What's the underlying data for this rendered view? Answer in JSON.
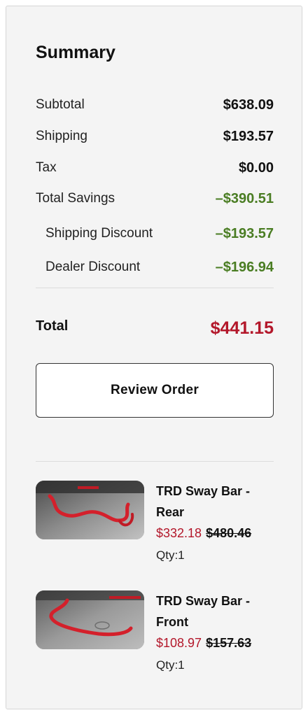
{
  "summary": {
    "title": "Summary",
    "rows": [
      {
        "label": "Subtotal",
        "value": "$638.09"
      },
      {
        "label": "Shipping",
        "value": "$193.57"
      },
      {
        "label": "Tax",
        "value": "$0.00"
      },
      {
        "label": "Total Savings",
        "value": "–$390.51"
      },
      {
        "label": "Shipping Discount",
        "value": "–$193.57"
      },
      {
        "label": "Dealer Discount",
        "value": "–$196.94"
      }
    ],
    "total_label": "Total",
    "total_value": "$441.15",
    "review_button": "Review Order"
  },
  "items": [
    {
      "name_line1": "TRD Sway Bar -",
      "name_line2": "Rear",
      "sale_price": "$332.18",
      "original_price": "$480.46",
      "qty": "Qty:1",
      "image": "red-sway-bar-rear-photo"
    },
    {
      "name_line1": "TRD Sway Bar -",
      "name_line2": "Front",
      "sale_price": "$108.97",
      "original_price": "$157.63",
      "qty": "Qty:1",
      "image": "red-sway-bar-front-photo"
    }
  ],
  "colors": {
    "savings_green": "#4a7d23",
    "total_red": "#b3172a",
    "panel_bg": "#f4f4f4"
  }
}
